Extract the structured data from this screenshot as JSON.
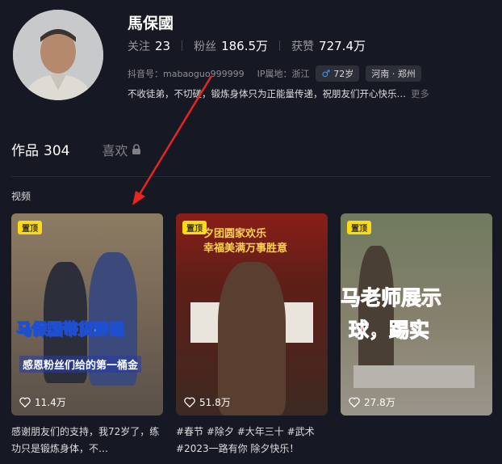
{
  "profile": {
    "name": "馬保國",
    "stats": [
      {
        "label": "关注",
        "value": "23"
      },
      {
        "label": "粉丝",
        "value": "186.5万"
      },
      {
        "label": "获赞",
        "value": "727.4万"
      }
    ],
    "douyin_id": "抖音号：mabaoguo999999",
    "ip_location": "IP属地：浙江",
    "age_badge": "72岁",
    "region_badge": "河南 · 郑州",
    "bio": "不收徒弟，不切磋，锻炼身体只为正能量传递，祝朋友们开心快乐…",
    "bio_more": "更多"
  },
  "tabs": {
    "works_label": "作品",
    "works_count": "304",
    "likes_label": "喜欢"
  },
  "section_title": "视频",
  "videos": [
    {
      "pin": "置顶",
      "overlay_main": "马保国带货辟谣",
      "overlay_sub": "感恩粉丝们给的第一桶金",
      "likes": "11.4万",
      "description": "感谢朋友们的支持，我72岁了，练功只是锻炼身体，不…"
    },
    {
      "pin": "置顶",
      "overlay_main": "夕团圆家欢乐",
      "overlay_sub": "幸福美满万事胜意",
      "likes": "51.8万",
      "description": "#春节 #除夕 #大年三十 #武术 #2023一路有你 除夕快乐！"
    },
    {
      "pin": "置顶",
      "overlay_main": "马老师展示",
      "overlay_sub": "球，踢实",
      "likes": "27.8万"
    }
  ],
  "colors": {
    "background": "#161823",
    "pin_badge": "#fadb14",
    "annotation_arrow": "#e8251e"
  },
  "icons": [
    "lock-icon",
    "heart-icon",
    "male-icon",
    "annotation-arrow"
  ]
}
